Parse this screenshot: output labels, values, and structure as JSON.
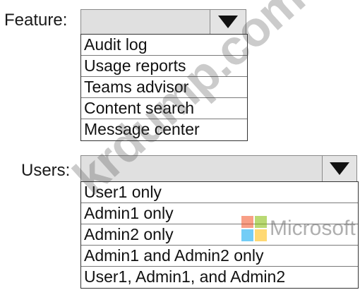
{
  "feature": {
    "label": "Feature:",
    "selected_value": "",
    "options": [
      "Audit log",
      "Usage reports",
      "Teams advisor",
      "Content search",
      "Message center"
    ]
  },
  "users": {
    "label": "Users:",
    "selected_value": "",
    "options": [
      "User1 only",
      "Admin1 only",
      "Admin2 only",
      "Admin1 and Admin2 only",
      "User1, Admin1, and Admin2"
    ]
  },
  "watermark": {
    "text": "krdump.com"
  },
  "brand": {
    "name": "Microsoft",
    "colors": [
      "#f25022",
      "#7fba00",
      "#00a4ef",
      "#ffb900"
    ]
  },
  "icons": {
    "dropdown": "triangle-down-icon"
  }
}
